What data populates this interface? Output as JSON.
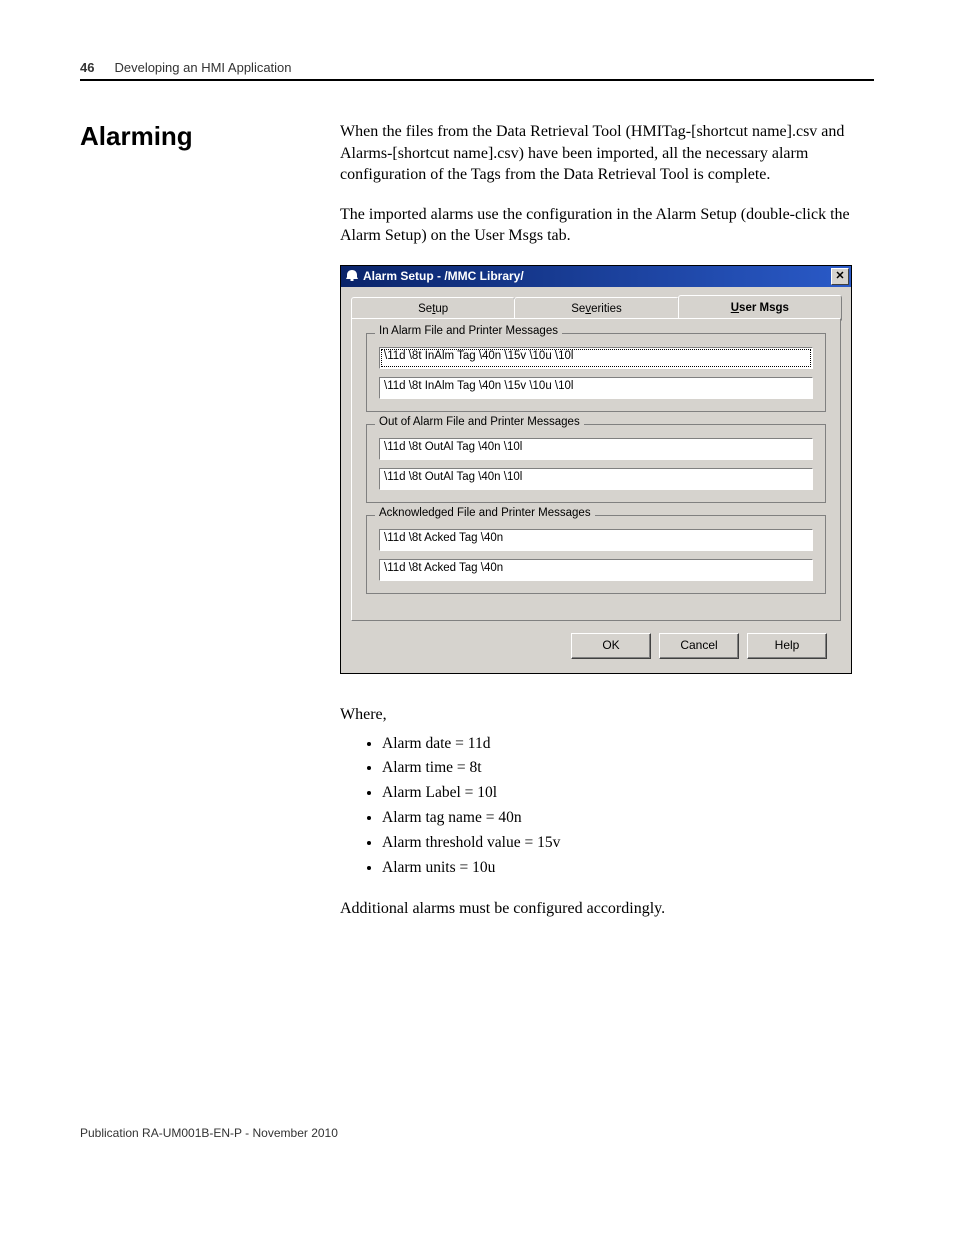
{
  "header": {
    "page_number": "46",
    "chapter_title": "Developing an HMI Application"
  },
  "section": {
    "heading": "Alarming",
    "para1": "When the files from the Data Retrieval Tool (HMITag-[shortcut name].csv and Alarms-[shortcut name].csv) have been imported, all the necessary alarm configuration of the Tags from the Data Retrieval Tool is complete.",
    "para2": "The imported alarms use the configuration in the Alarm Setup (double-click the Alarm Setup) on the User Msgs tab."
  },
  "dialog": {
    "title": "Alarm Setup - /MMC Library/",
    "tabs": {
      "setup": "Setup",
      "severities": "Severities",
      "user_msgs": "User Msgs"
    },
    "groups": {
      "in_alarm": {
        "legend": "In Alarm File and Printer Messages",
        "field1": "\\11d \\8t InAlm Tag \\40n \\15v \\10u \\10l",
        "field2": "\\11d \\8t InAlm Tag \\40n \\15v \\10u \\10l"
      },
      "out_of_alarm": {
        "legend": "Out of Alarm File and Printer Messages",
        "field1": "\\11d \\8t OutAl Tag \\40n \\10l",
        "field2": "\\11d \\8t OutAl Tag \\40n \\10l"
      },
      "acknowledged": {
        "legend": "Acknowledged File and Printer Messages",
        "field1": "\\11d \\8t Acked Tag \\40n",
        "field2": "\\11d \\8t Acked Tag \\40n"
      }
    },
    "buttons": {
      "ok": "OK",
      "cancel": "Cancel",
      "help": "Help"
    }
  },
  "where": {
    "label": "Where,",
    "items": [
      "Alarm date = 11d",
      "Alarm time = 8t",
      "Alarm Label = 10l",
      "Alarm tag name = 40n",
      "Alarm threshold value = 15v",
      "Alarm units = 10u"
    ],
    "closing": "Additional alarms must be configured accordingly."
  },
  "footer": {
    "publication": "Publication RA-UM001B-EN-P - November 2010"
  }
}
